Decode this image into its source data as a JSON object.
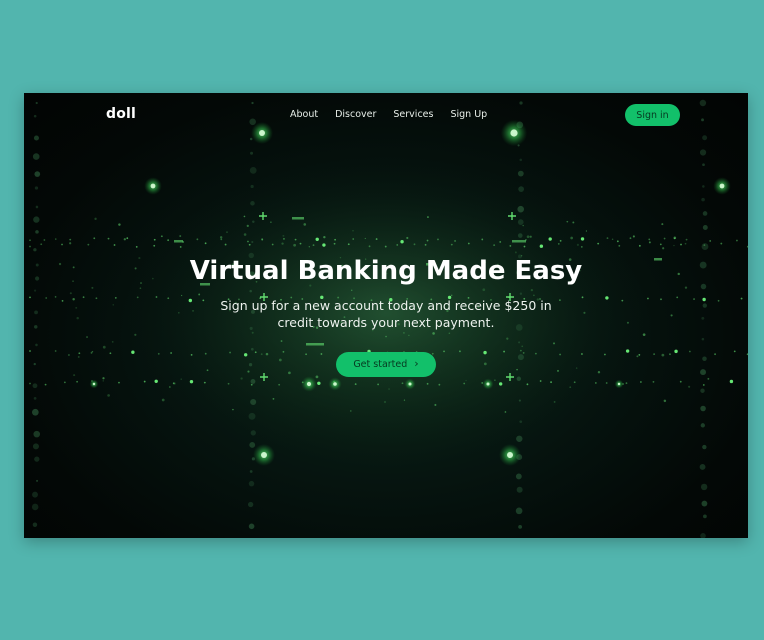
{
  "brand": {
    "name": "doll"
  },
  "nav": {
    "links": [
      "About",
      "Discover",
      "Services",
      "Sign Up"
    ],
    "signin_label": "Sign in"
  },
  "hero": {
    "title": "Virtual Banking Made Easy",
    "subtitle": "Sign up for a new account today and receive $250 in credit towards your next payment.",
    "cta_label": "Get started",
    "cta_icon": "chevron-right-icon"
  },
  "colors": {
    "outer_background": "#52b5ae",
    "page_background": "#030806",
    "accent": "#12c06a",
    "particle": "#6cf27a",
    "text": "#ffffff"
  }
}
